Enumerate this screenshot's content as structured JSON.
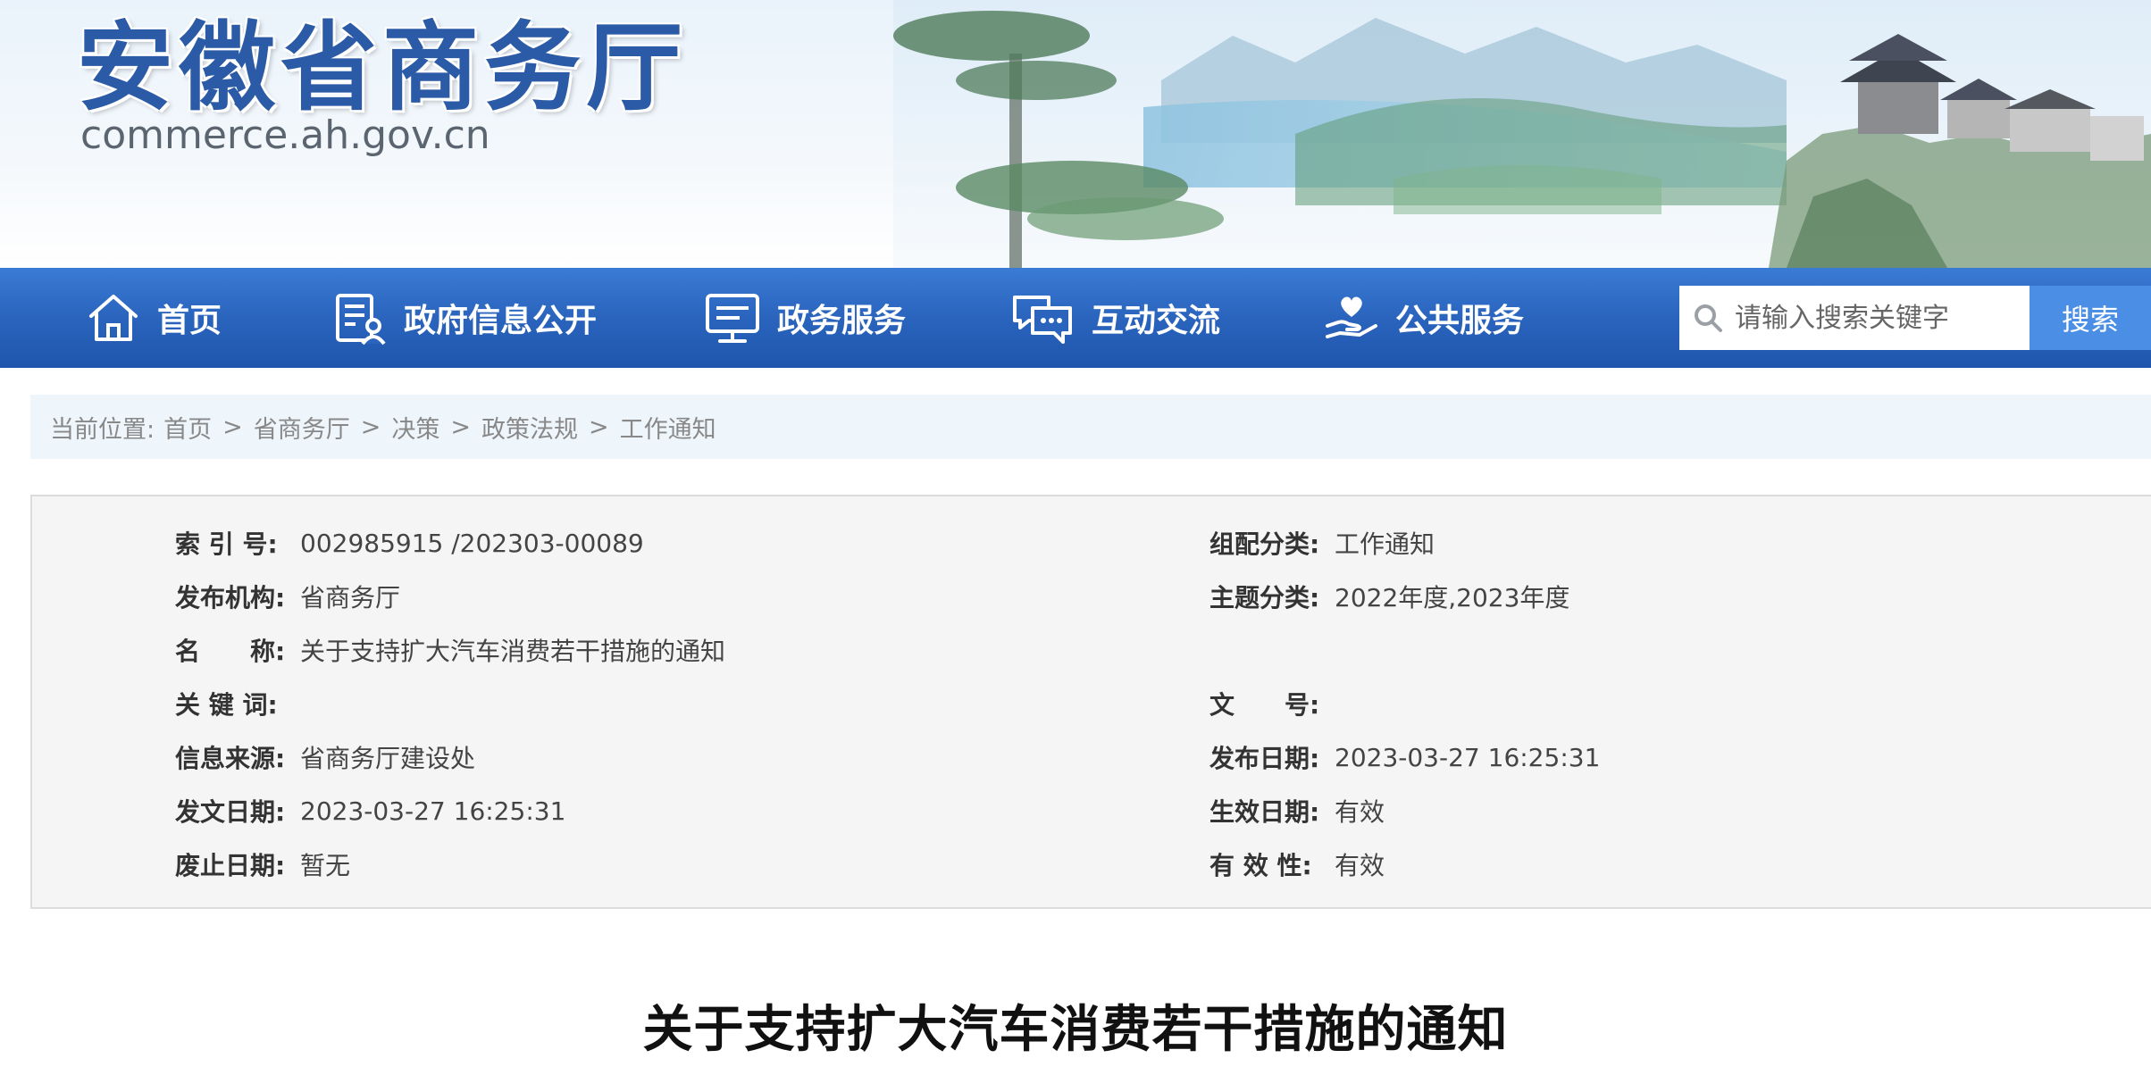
{
  "header": {
    "site_title": "安徽省商务厅",
    "site_domain": "commerce.ah.gov.cn"
  },
  "nav": {
    "items": [
      {
        "label": "首页",
        "icon": "home-icon"
      },
      {
        "label": "政府信息公开",
        "icon": "document-user-icon"
      },
      {
        "label": "政务服务",
        "icon": "monitor-icon"
      },
      {
        "label": "互动交流",
        "icon": "chat-icon"
      },
      {
        "label": "公共服务",
        "icon": "heart-hand-icon"
      }
    ],
    "search": {
      "placeholder": "请输入搜索关键字",
      "button_label": "搜索"
    }
  },
  "breadcrumb": {
    "label": "当前位置:",
    "items": [
      "首页",
      "省商务厅",
      "决策",
      "政策法规",
      "工作通知"
    ],
    "separator": ">"
  },
  "meta": {
    "left": [
      {
        "label": "索 引 号:",
        "value": "002985915 /202303-00089"
      },
      {
        "label": "发布机构:",
        "value": "省商务厅"
      },
      {
        "label": "名　　称:",
        "value": "关于支持扩大汽车消费若干措施的通知"
      },
      {
        "label": "关 键 词:",
        "value": ""
      },
      {
        "label": "信息来源:",
        "value": "省商务厅建设处"
      },
      {
        "label": "发文日期:",
        "value": "2023-03-27 16:25:31"
      },
      {
        "label": "废止日期:",
        "value": "暂无"
      }
    ],
    "right": [
      {
        "label": "组配分类:",
        "value": "工作通知"
      },
      {
        "label": "主题分类:",
        "value": "2022年度,2023年度"
      },
      {
        "label": "文　　号:",
        "value": ""
      },
      {
        "label": "发布日期:",
        "value": "2023-03-27 16:25:31"
      },
      {
        "label": "生效日期:",
        "value": "有效"
      },
      {
        "label": "有 效 性:",
        "value": "有效"
      }
    ]
  },
  "article": {
    "title": "关于支持扩大汽车消费若干措施的通知"
  },
  "colors": {
    "nav_blue": "#2a64bd",
    "title_blue": "#2b5aa6",
    "search_button": "#4b8ee6",
    "breadcrumb_bg": "#eef6fc",
    "meta_bg": "#f5f5f5"
  }
}
